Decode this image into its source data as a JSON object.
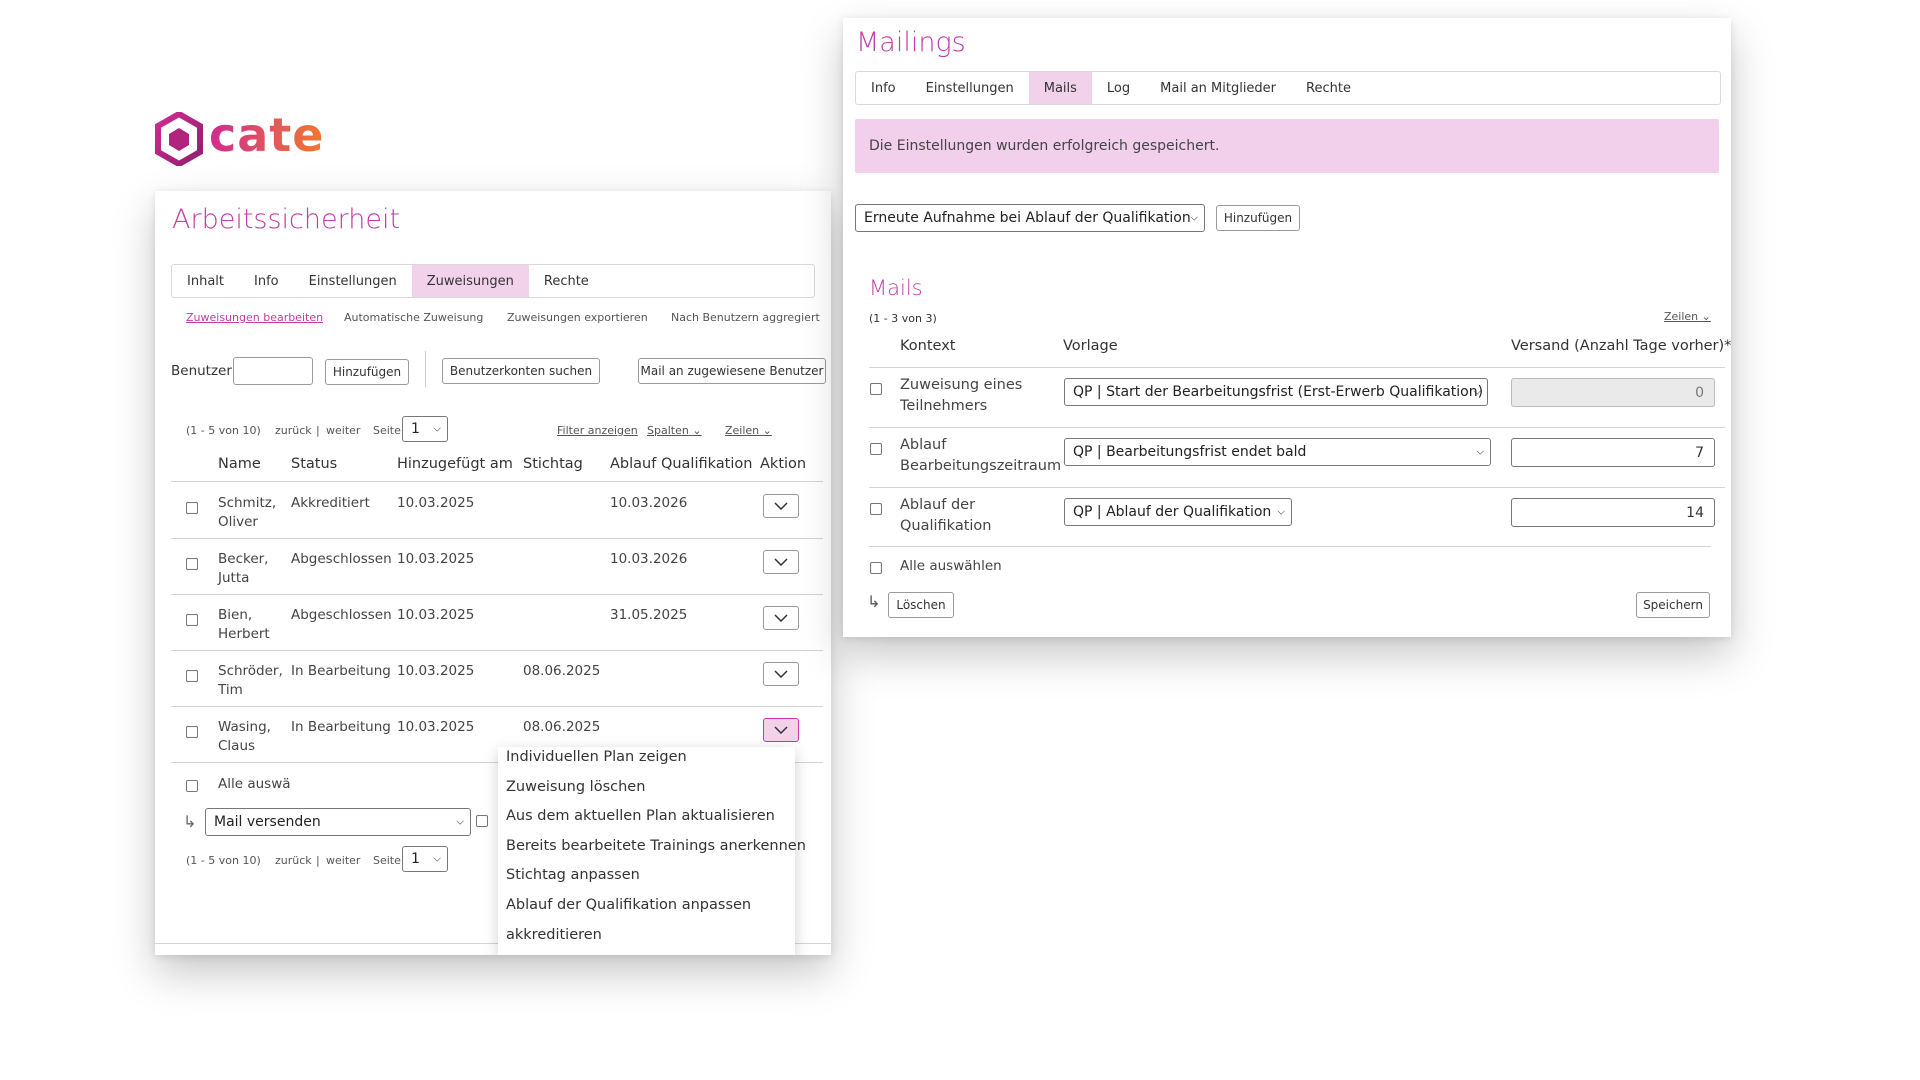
{
  "brand": {
    "name": "cate",
    "color_dark": "#b0237f",
    "color_light": "#f07a2e"
  },
  "colors": {
    "accent": "#c43aa6",
    "active_tab": "#f2d2eb",
    "alert_bg": "#f2cfea"
  },
  "left": {
    "title": "Arbeitssicherheit",
    "tabs": [
      "Inhalt",
      "Info",
      "Einstellungen",
      "Zuweisungen",
      "Rechte"
    ],
    "active_tab": "Zuweisungen",
    "subtabs": [
      "Zuweisungen bearbeiten",
      "Automatische Zuweisung",
      "Zuweisungen exportieren",
      "Nach Benutzern aggregiert"
    ],
    "benutzer_label": "Benutzer",
    "add_button": "Hinzufügen",
    "search_accounts_button": "Benutzerkonten suchen",
    "mail_button": "Mail an zugewiesene Benutzer",
    "pagination": {
      "range": "(1 - 5 von 10)",
      "back": "zurück",
      "sep": "|",
      "next": "weiter",
      "page_label": "Seite",
      "page": "1"
    },
    "filter_link": "Filter anzeigen",
    "columns_link": "Spalten",
    "rows_link": "Zeilen",
    "headers": [
      "Name",
      "Status",
      "Hinzugefügt am",
      "Stichtag",
      "Ablauf Qualifikation",
      "Aktion"
    ],
    "rows": [
      {
        "name1": "Schmitz,",
        "name2": "Oliver",
        "status": "Akkreditiert",
        "added": "10.03.2025",
        "stichtag": "",
        "ablauf": "10.03.2026"
      },
      {
        "name1": "Becker,",
        "name2": "Jutta",
        "status": "Abgeschlossen",
        "added": "10.03.2025",
        "stichtag": "",
        "ablauf": "10.03.2026"
      },
      {
        "name1": "Bien,",
        "name2": "Herbert",
        "status": "Abgeschlossen",
        "added": "10.03.2025",
        "stichtag": "",
        "ablauf": "31.05.2025"
      },
      {
        "name1": "Schröder,",
        "name2": "Tim",
        "status": "In Bearbeitung",
        "added": "10.03.2025",
        "stichtag": "08.06.2025",
        "ablauf": ""
      },
      {
        "name1": "Wasing,",
        "name2": "Claus",
        "status": "In Bearbeitung",
        "added": "10.03.2025",
        "stichtag": "08.06.2025",
        "ablauf": ""
      }
    ],
    "select_all": "Alle auswä",
    "bulk_action": "Mail versenden",
    "dropdown_menu": [
      "Individuellen Plan zeigen",
      "Zuweisung löschen",
      "Aus dem aktuellen Plan aktualisieren",
      "Bereits bearbeitete Trainings anerkennen",
      "Stichtag anpassen",
      "Ablauf der Qualifikation anpassen",
      "akkreditieren"
    ]
  },
  "right": {
    "title": "Mailings",
    "tabs": [
      "Info",
      "Einstellungen",
      "Mails",
      "Log",
      "Mail an Mitglieder",
      "Rechte"
    ],
    "active_tab": "Mails",
    "alert": "Die Einstellungen wurden erfolgreich gespeichert.",
    "type_select": "Erneute Aufnahme bei Ablauf der Qualifikation",
    "add_button": "Hinzufügen",
    "section_title": "Mails",
    "range": "(1 - 3 von 3)",
    "rows_link": "Zeilen",
    "headers": [
      "Kontext",
      "Vorlage",
      "Versand (Anzahl Tage vorher)*"
    ],
    "rows": [
      {
        "ctx1": "Zuweisung eines",
        "ctx2": "Teilnehmers",
        "template": "QP | Start der Bearbeitungsfrist (Erst-Erwerb Qualifikation)",
        "days": "0",
        "disabled": true
      },
      {
        "ctx1": "Ablauf",
        "ctx2": "Bearbeitungszeitraum",
        "template": "QP | Bearbeitungsfrist endet bald",
        "days": "7",
        "disabled": false
      },
      {
        "ctx1": "Ablauf der",
        "ctx2": "Qualifikation",
        "template": "QP | Ablauf der Qualifikation",
        "days": "14",
        "disabled": false
      }
    ],
    "select_all": "Alle auswählen",
    "delete_button": "Löschen",
    "save_button": "Speichern"
  }
}
